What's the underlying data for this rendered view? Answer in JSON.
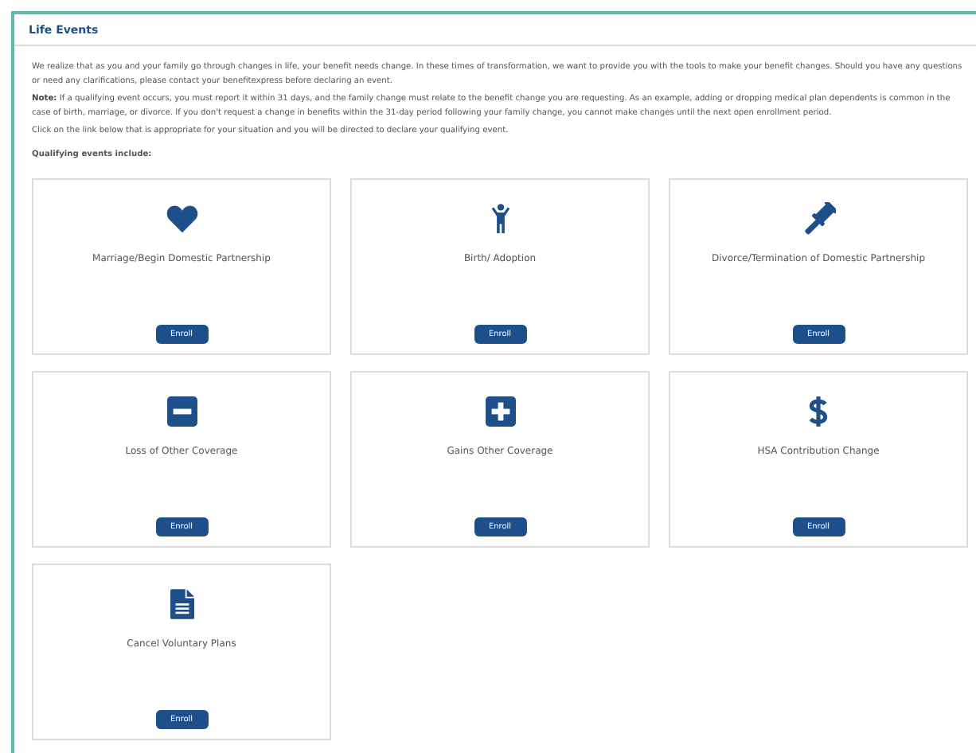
{
  "panel": {
    "title": "Life Events"
  },
  "intro": "We realize that as you and your family go through changes in life, your benefit needs change. In these times of transformation, we want to provide you with the tools to make your benefit changes.  Should you have any questions or need any clarifications, please contact your benefitexpress before declaring an event.",
  "note": "**Note:** If a qualifying event occurs, you must report it within 31 days, and the family change must relate to the benefit change you are requesting. As an example, adding or dropping medical plan dependents is common in the case of birth, marriage, or divorce.  If you don't request a change in benefits within the 31-day period following your family change, you cannot make changes until the next open enrollment period.",
  "instruction": "Click on the link below that is appropriate for your situation and you will be directed to declare your qualifying event.",
  "events_heading": "Qualifying events include:",
  "events": [
    {
      "kind": "heart",
      "label": "Marriage/Begin Domestic Partnership",
      "button": "Enroll"
    },
    {
      "kind": "child",
      "label": "Birth/ Adoption",
      "button": "Enroll"
    },
    {
      "kind": "gavel",
      "label": "Divorce/Termination of Domestic Partnership",
      "button": "Enroll"
    },
    {
      "kind": "minus",
      "label": "Loss of Other Coverage",
      "button": "Enroll"
    },
    {
      "kind": "plus",
      "label": "Gains Other Coverage",
      "button": "Enroll"
    },
    {
      "kind": "dollar",
      "label": "HSA Contribution Change",
      "button": "Enroll"
    },
    {
      "kind": "document",
      "label": "Cancel Voluntary Plans",
      "button": "Enroll"
    }
  ]
}
